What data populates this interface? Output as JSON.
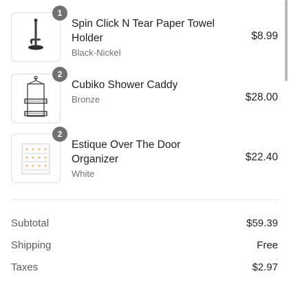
{
  "line_items": [
    {
      "quantity": "1",
      "name": "Spin Click N Tear Paper Towel Holder",
      "variant": "Black-Nickel",
      "price": "$8.99",
      "thumbnail_icon": "paper-towel-holder-image"
    },
    {
      "quantity": "2",
      "name": "Cubiko Shower Caddy",
      "variant": "Bronze",
      "price": "$28.00",
      "thumbnail_icon": "shower-caddy-image"
    },
    {
      "quantity": "2",
      "name": "Estique Over The Door Organizer",
      "variant": "White",
      "price": "$22.40",
      "thumbnail_icon": "door-organizer-image"
    }
  ],
  "summary": {
    "subtotal_label": "Subtotal",
    "subtotal_value": "$59.39",
    "shipping_label": "Shipping",
    "shipping_value": "Free",
    "taxes_label": "Taxes",
    "taxes_value": "$2.97"
  },
  "colors": {
    "badge": "#707070",
    "secondary_text": "#717171",
    "border": "#dcdcdc"
  }
}
